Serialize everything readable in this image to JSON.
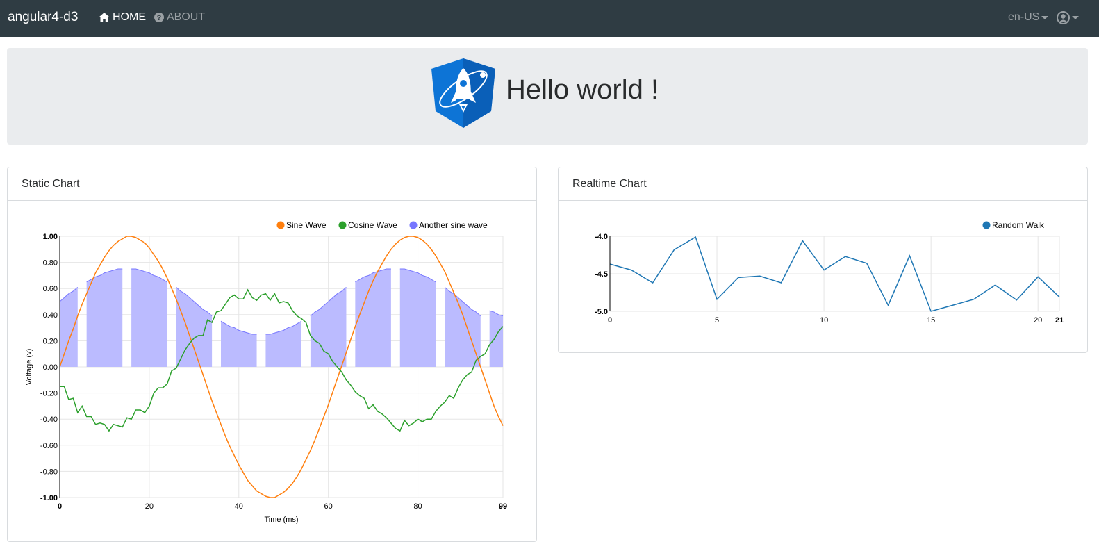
{
  "navbar": {
    "brand": "angular4-d3",
    "links": [
      {
        "label": "HOME",
        "icon": "home-icon",
        "active": true
      },
      {
        "label": "ABOUT",
        "icon": "question-circle-icon",
        "active": false
      }
    ],
    "language": "en-US",
    "user_icon": "user-circle-icon"
  },
  "hero": {
    "title": "Hello world !",
    "logo": "angular-rocket-logo"
  },
  "static_card": {
    "header": "Static Chart"
  },
  "realtime_card": {
    "header": "Realtime Chart"
  },
  "colors": {
    "navbar_bg": "#2f3c43",
    "sine": "#ff7f0e",
    "cosine": "#2ca02c",
    "another_sine": "#7777ff",
    "another_sine_fill": "#bbbbff",
    "random_walk": "#1f77b4"
  },
  "chart_data": [
    {
      "type": "line",
      "title": "",
      "xlabel": "Time (ms)",
      "ylabel": "Voltage (v)",
      "xlim": [
        0,
        99
      ],
      "ylim": [
        -1,
        1
      ],
      "x_ticks": [
        "0",
        "20",
        "40",
        "60",
        "80",
        "99"
      ],
      "y_ticks": [
        "-1.00",
        "-0.80",
        "-0.60",
        "-0.40",
        "-0.20",
        "0.00",
        "0.20",
        "0.40",
        "0.60",
        "0.80",
        "1.00"
      ],
      "grid": true,
      "legend_position": "top-right",
      "x": [
        0,
        1,
        2,
        3,
        4,
        5,
        6,
        7,
        8,
        9,
        10,
        11,
        12,
        13,
        14,
        15,
        16,
        17,
        18,
        19,
        20,
        21,
        22,
        23,
        24,
        25,
        26,
        27,
        28,
        29,
        30,
        31,
        32,
        33,
        34,
        35,
        36,
        37,
        38,
        39,
        40,
        41,
        42,
        43,
        44,
        45,
        46,
        47,
        48,
        49,
        50,
        51,
        52,
        53,
        54,
        55,
        56,
        57,
        58,
        59,
        60,
        61,
        62,
        63,
        64,
        65,
        66,
        67,
        68,
        69,
        70,
        71,
        72,
        73,
        74,
        75,
        76,
        77,
        78,
        79,
        80,
        81,
        82,
        83,
        84,
        85,
        86,
        87,
        88,
        89,
        90,
        91,
        92,
        93,
        94,
        95,
        96,
        97,
        98,
        99
      ],
      "series": [
        {
          "name": "Sine Wave",
          "values": [
            0.0,
            0.1,
            0.2,
            0.29,
            0.39,
            0.48,
            0.56,
            0.64,
            0.72,
            0.78,
            0.84,
            0.89,
            0.93,
            0.96,
            0.98,
            1.0,
            1.0,
            0.99,
            0.97,
            0.95,
            0.91,
            0.86,
            0.81,
            0.75,
            0.68,
            0.6,
            0.52,
            0.43,
            0.34,
            0.24,
            0.14,
            0.04,
            -0.06,
            -0.16,
            -0.26,
            -0.35,
            -0.44,
            -0.53,
            -0.61,
            -0.68,
            -0.75,
            -0.81,
            -0.87,
            -0.91,
            -0.95,
            -0.97,
            -0.99,
            -1.0,
            -1.0,
            -0.98,
            -0.96,
            -0.93,
            -0.89,
            -0.84,
            -0.78,
            -0.71,
            -0.64,
            -0.56,
            -0.47,
            -0.38,
            -0.29,
            -0.19,
            -0.09,
            0.01,
            0.11,
            0.21,
            0.31,
            0.4,
            0.49,
            0.58,
            0.66,
            0.73,
            0.79,
            0.85,
            0.9,
            0.94,
            0.97,
            0.99,
            1.0,
            1.0,
            0.99,
            0.97,
            0.94,
            0.9,
            0.85,
            0.79,
            0.73,
            0.65,
            0.57,
            0.49,
            0.4,
            0.3,
            0.2,
            0.1,
            0.0,
            -0.1,
            -0.2,
            -0.3,
            -0.38,
            -0.45
          ]
        },
        {
          "name": "Cosine Wave",
          "values": [
            -0.15,
            -0.15,
            -0.25,
            -0.24,
            -0.35,
            -0.3,
            -0.38,
            -0.38,
            -0.44,
            -0.43,
            -0.44,
            -0.49,
            -0.44,
            -0.45,
            -0.46,
            -0.39,
            -0.4,
            -0.33,
            -0.33,
            -0.35,
            -0.3,
            -0.2,
            -0.16,
            -0.16,
            -0.13,
            -0.03,
            -0.01,
            0.06,
            0.13,
            0.18,
            0.22,
            0.24,
            0.24,
            0.36,
            0.34,
            0.42,
            0.43,
            0.48,
            0.53,
            0.55,
            0.52,
            0.52,
            0.59,
            0.53,
            0.51,
            0.55,
            0.56,
            0.51,
            0.56,
            0.49,
            0.5,
            0.49,
            0.43,
            0.39,
            0.37,
            0.34,
            0.24,
            0.2,
            0.18,
            0.12,
            0.1,
            0.04,
            0.0,
            -0.04,
            -0.1,
            -0.14,
            -0.19,
            -0.22,
            -0.24,
            -0.32,
            -0.29,
            -0.34,
            -0.36,
            -0.39,
            -0.43,
            -0.47,
            -0.49,
            -0.41,
            -0.45,
            -0.43,
            -0.4,
            -0.42,
            -0.4,
            -0.4,
            -0.34,
            -0.3,
            -0.27,
            -0.22,
            -0.24,
            -0.16,
            -0.1,
            -0.06,
            -0.04,
            0.05,
            0.08,
            0.1,
            0.17,
            0.21,
            0.27,
            0.31
          ]
        },
        {
          "name": "Another sine wave",
          "type": "area",
          "values": [
            0.5,
            0.53,
            0.56,
            0.58,
            0.61,
            0.63,
            0.65,
            0.67,
            0.69,
            0.7,
            0.72,
            0.73,
            0.74,
            0.75,
            0.75,
            0.75,
            0.75,
            0.75,
            0.74,
            0.73,
            0.72,
            0.7,
            0.69,
            0.67,
            0.65,
            0.63,
            0.61,
            0.58,
            0.56,
            0.53,
            0.5,
            0.47,
            0.44,
            0.42,
            0.39,
            0.37,
            0.35,
            0.33,
            0.31,
            0.3,
            0.28,
            0.27,
            0.26,
            0.25,
            0.25,
            0.25,
            0.25,
            0.25,
            0.26,
            0.27,
            0.28,
            0.3,
            0.31,
            0.33,
            0.35,
            0.37,
            0.39,
            0.42,
            0.44,
            0.47,
            0.5,
            0.53,
            0.56,
            0.58,
            0.61,
            0.63,
            0.65,
            0.67,
            0.69,
            0.7,
            0.72,
            0.73,
            0.74,
            0.75,
            0.75,
            0.75,
            0.75,
            0.75,
            0.74,
            0.73,
            0.72,
            0.7,
            0.69,
            0.67,
            0.65,
            0.63,
            0.61,
            0.58,
            0.56,
            0.53,
            0.5,
            0.47,
            0.44,
            0.42,
            0.39,
            0.45,
            0.43,
            0.42,
            0.4,
            0.39
          ]
        }
      ]
    },
    {
      "type": "line",
      "title": "",
      "xlabel": "",
      "ylabel": "",
      "xlim": [
        0,
        21
      ],
      "ylim": [
        -5.0,
        -4.0
      ],
      "x_ticks": [
        "0",
        "5",
        "10",
        "15",
        "20",
        "21"
      ],
      "y_ticks": [
        "-5.0",
        "-4.5",
        "-4.0"
      ],
      "grid": true,
      "legend_position": "top-right",
      "x": [
        0,
        1,
        2,
        3,
        4,
        5,
        6,
        7,
        8,
        9,
        10,
        11,
        12,
        13,
        14,
        15,
        16,
        17,
        18,
        19,
        20,
        21
      ],
      "series": [
        {
          "name": "Random Walk",
          "values": [
            -4.37,
            -4.45,
            -4.62,
            -4.18,
            -4.01,
            -4.84,
            -4.55,
            -4.53,
            -4.62,
            -4.06,
            -4.45,
            -4.27,
            -4.36,
            -4.92,
            -4.26,
            -5.0,
            -4.92,
            -4.84,
            -4.65,
            -4.85,
            -4.54,
            -4.81
          ]
        }
      ]
    }
  ]
}
